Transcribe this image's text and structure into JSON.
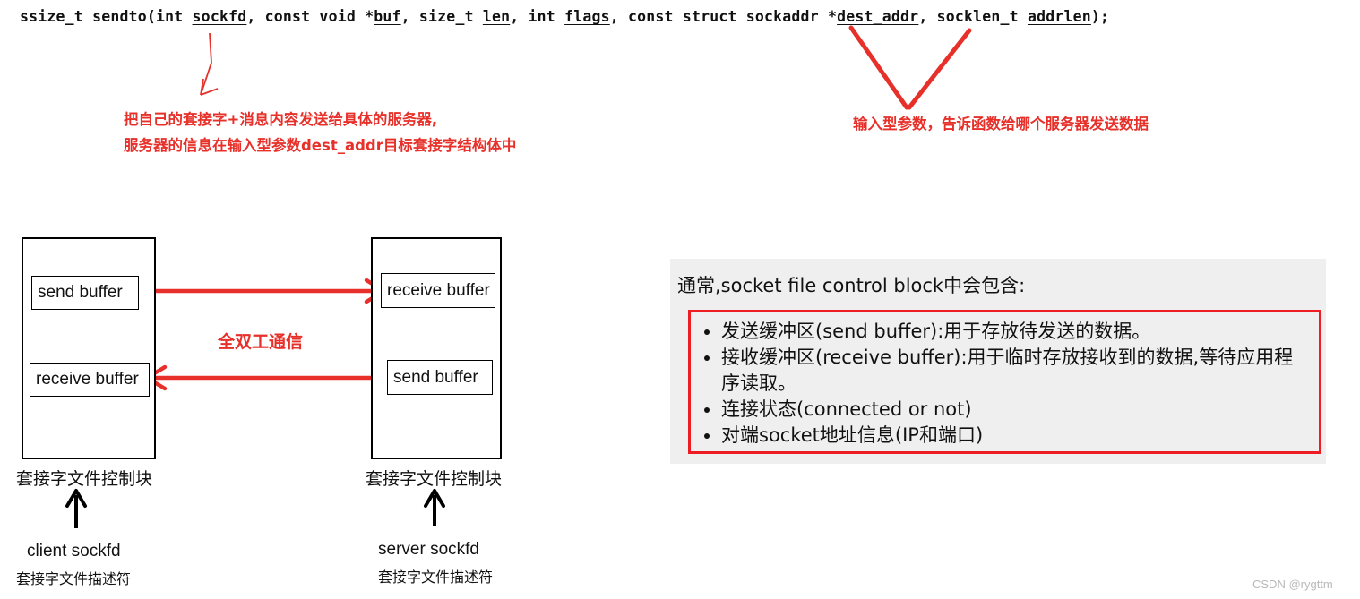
{
  "signature": {
    "tokens": [
      {
        "text": "ssize_t sendto(int ",
        "param": false
      },
      {
        "text": "sockfd",
        "param": true
      },
      {
        "text": ", const void *",
        "param": false
      },
      {
        "text": "buf",
        "param": true
      },
      {
        "text": ", size_t ",
        "param": false
      },
      {
        "text": "len",
        "param": true
      },
      {
        "text": ", int ",
        "param": false
      },
      {
        "text": "flags",
        "param": true
      },
      {
        "text": ", const struct sockaddr *",
        "param": false
      },
      {
        "text": "dest_addr",
        "param": true
      },
      {
        "text": ", socklen_t ",
        "param": false
      },
      {
        "text": "addrlen",
        "param": true
      },
      {
        "text": ");",
        "param": false
      }
    ],
    "plain": "ssize_t sendto(int sockfd, const void *buf, size_t len, int flags, const struct sockaddr *dest_addr, socklen_t addrlen);"
  },
  "annotations": {
    "accent_color": "#e8302a",
    "left": {
      "line1": "把自己的套接字+消息内容发送给具体的服务器,",
      "line2": "服务器的信息在输入型参数dest_addr目标套接字结构体中"
    },
    "right": {
      "line1": "输入型参数，告诉函数给哪个服务器发送数据"
    }
  },
  "diagram": {
    "duplex_label": "全双工通信",
    "client": {
      "caption": "套接字文件控制块",
      "fd_label": "client sockfd",
      "fd_sub": "套接字文件描述符",
      "buffers": {
        "send": "send buffer",
        "receive": "receive buffer"
      }
    },
    "server": {
      "caption": "套接字文件控制块",
      "fd_label": "server sockfd",
      "fd_sub": "套接字文件描述符",
      "buffers": {
        "receive": "receive buffer",
        "send": "send buffer"
      }
    }
  },
  "info_panel": {
    "title": "通常,socket file control block中会包含:",
    "border_color": "#ee1c23",
    "background_color": "#efefef",
    "items": [
      "发送缓冲区(send buffer):用于存放待发送的数据。",
      "接收缓冲区(receive buffer):用于临时存放接收到的数据,等待应用程序读取。",
      "连接状态(connected or not)",
      "对端socket地址信息(IP和端口)"
    ]
  },
  "watermark": "CSDN @rygttm"
}
